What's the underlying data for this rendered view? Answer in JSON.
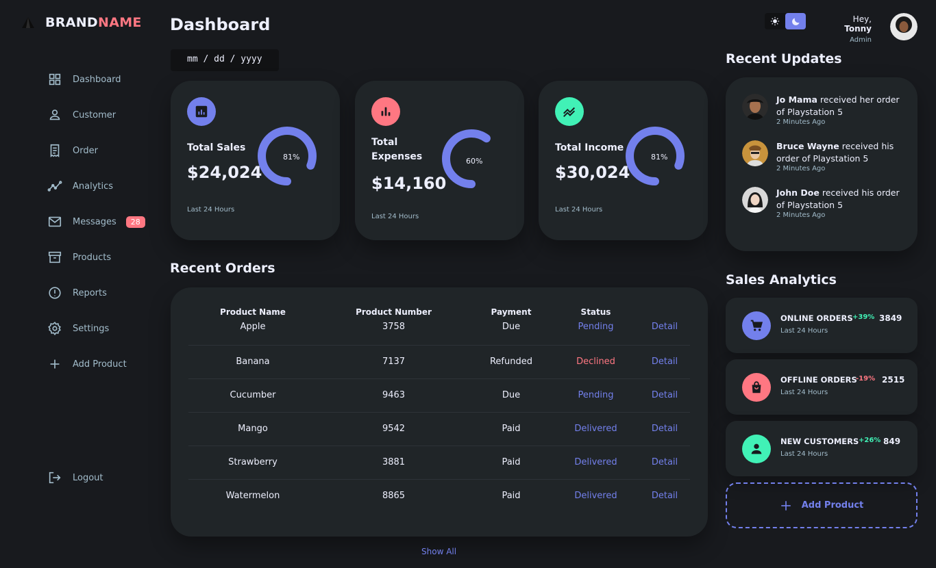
{
  "brand": {
    "part1": "BRAND",
    "part2": "NAME"
  },
  "sidebar": {
    "items": [
      {
        "label": "Dashboard",
        "icon": "grid-icon"
      },
      {
        "label": "Customer",
        "icon": "person-icon"
      },
      {
        "label": "Order",
        "icon": "receipt-icon"
      },
      {
        "label": "Analytics",
        "icon": "insights-icon"
      },
      {
        "label": "Messages",
        "icon": "mail-icon",
        "badge": "28"
      },
      {
        "label": "Products",
        "icon": "inventory-icon"
      },
      {
        "label": "Reports",
        "icon": "report-icon"
      },
      {
        "label": "Settings",
        "icon": "gear-icon"
      },
      {
        "label": "Add Product",
        "icon": "plus-icon"
      }
    ],
    "logout": "Logout"
  },
  "header": {
    "title": "Dashboard",
    "date_placeholder": "mm / dd / yyyy",
    "greeting": "Hey,",
    "user_name": "Tonny",
    "role": "Admin"
  },
  "kpis": [
    {
      "label": "Total Sales",
      "amount": "$24,024",
      "percent_label": "81%",
      "percent": 81,
      "footer": "Last 24 Hours",
      "color": "#7380ec",
      "icon": "analytics-icon"
    },
    {
      "label": "Total Expenses",
      "amount": "$14,160",
      "percent_label": "60%",
      "percent": 60,
      "footer": "Last 24 Hours",
      "color": "#ff7782",
      "icon": "bar-chart-icon"
    },
    {
      "label": "Total Income",
      "amount": "$30,024",
      "percent_label": "81%",
      "percent": 81,
      "footer": "Last 24 Hours",
      "color": "#41f1b6",
      "icon": "stocks-icon"
    }
  ],
  "orders": {
    "title": "Recent Orders",
    "columns": [
      "Product Name",
      "Product Number",
      "Payment",
      "Status"
    ],
    "rows": [
      {
        "name": "Apple",
        "number": "3758",
        "payment": "Due",
        "status": "Pending",
        "detail": "Detail"
      },
      {
        "name": "Banana",
        "number": "7137",
        "payment": "Refunded",
        "status": "Declined",
        "detail": "Detail"
      },
      {
        "name": "Cucumber",
        "number": "9463",
        "payment": "Due",
        "status": "Pending",
        "detail": "Detail"
      },
      {
        "name": "Mango",
        "number": "9542",
        "payment": "Paid",
        "status": "Delivered",
        "detail": "Detail"
      },
      {
        "name": "Strawberry",
        "number": "3881",
        "payment": "Paid",
        "status": "Delivered",
        "detail": "Detail"
      },
      {
        "name": "Watermelon",
        "number": "8865",
        "payment": "Paid",
        "status": "Delivered",
        "detail": "Detail"
      }
    ],
    "show_all": "Show All"
  },
  "updates": {
    "title": "Recent Updates",
    "items": [
      {
        "name": "Jo Mama",
        "text": "received her order of Playstation 5",
        "ago": "2 Minutes Ago"
      },
      {
        "name": "Bruce Wayne",
        "text": "received his order of Playstation 5",
        "ago": "2 Minutes Ago"
      },
      {
        "name": "John Doe",
        "text": "received his order of Playstation 5",
        "ago": "2 Minutes Ago"
      }
    ]
  },
  "sales_analytics": {
    "title": "Sales Analytics",
    "items": [
      {
        "title": "ONLINE ORDERS",
        "sub": "Last 24 Hours",
        "change": "+39%",
        "value": "3849",
        "color": "#7380ec",
        "icon": "cart-icon"
      },
      {
        "title": "OFFLINE ORDERS",
        "sub": "Last 24 Hours",
        "change": "-19%",
        "value": "2515",
        "color": "#ff7782",
        "icon": "shopping-bag-icon"
      },
      {
        "title": "NEW CUSTOMERS",
        "sub": "Last 24 Hours",
        "change": "+26%",
        "value": "849",
        "color": "#41f1b6",
        "icon": "person-icon"
      }
    ],
    "add_product": "Add Product"
  },
  "colors": {
    "primary": "#7380ec",
    "danger": "#ff7782",
    "success": "#41f1b6",
    "background": "#181a1e",
    "card": "#202528"
  }
}
